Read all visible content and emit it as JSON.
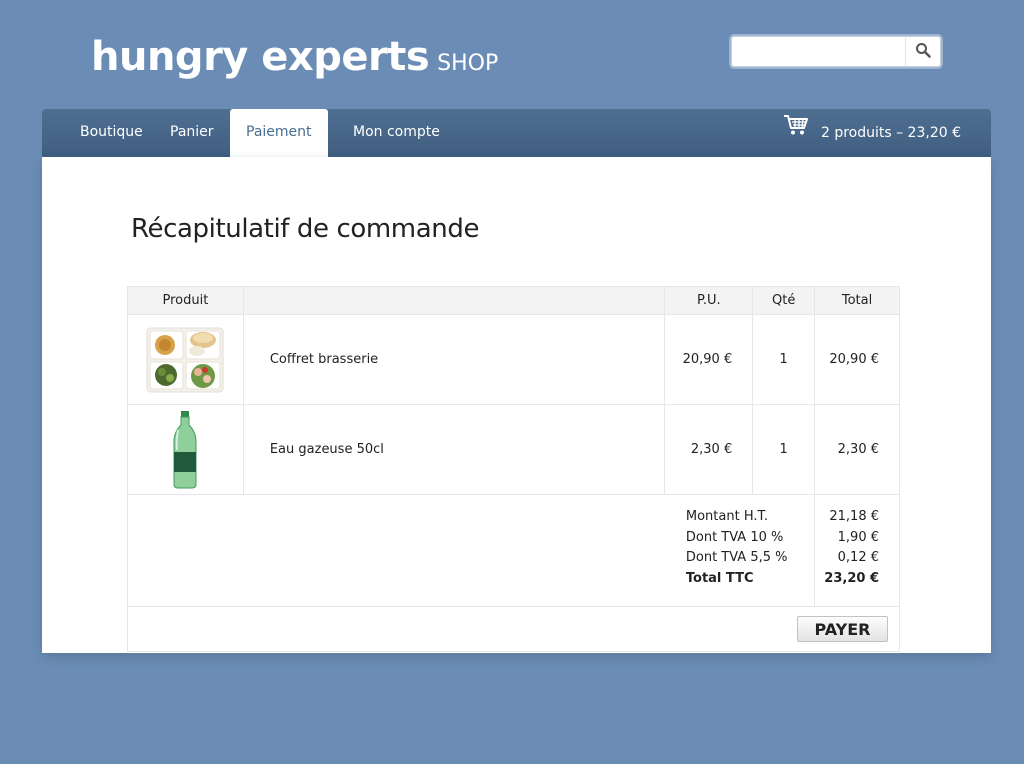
{
  "header": {
    "brand": "hungry experts",
    "shop_label": "SHOP"
  },
  "search": {
    "value": "",
    "placeholder": ""
  },
  "nav": {
    "items": [
      {
        "label": "Boutique"
      },
      {
        "label": "Panier"
      },
      {
        "label": "Paiement",
        "active": true
      },
      {
        "label": "Mon compte"
      }
    ],
    "cart_summary": "2 produits – 23,20 €"
  },
  "page": {
    "title": "Récapitulatif de commande"
  },
  "table": {
    "headers": {
      "product": "Produit",
      "unit_price": "P.U.",
      "qty": "Qté",
      "total": "Total"
    },
    "rows": [
      {
        "image_icon": "food-box-image",
        "name": "Coffret brasserie",
        "unit_price": "20,90 €",
        "qty": "1",
        "total": "20,90 €"
      },
      {
        "image_icon": "water-bottle-image",
        "name": "Eau gazeuse 50cl",
        "unit_price": "2,30 €",
        "qty": "1",
        "total": "2,30 €"
      }
    ]
  },
  "totals": {
    "ht_label": "Montant H.T.",
    "ht_value": "21,18 €",
    "tva10_label": "Dont TVA 10 %",
    "tva10_value": "1,90 €",
    "tva55_label": "Dont TVA 5,5 %",
    "tva55_value": "0,12 €",
    "ttc_label": "Total TTC",
    "ttc_value": "23,20 €"
  },
  "pay_button": "PAYER",
  "colors": {
    "background": "#6b8db5",
    "navbar": "#46658a",
    "active_tab_text": "#4a6d92"
  }
}
